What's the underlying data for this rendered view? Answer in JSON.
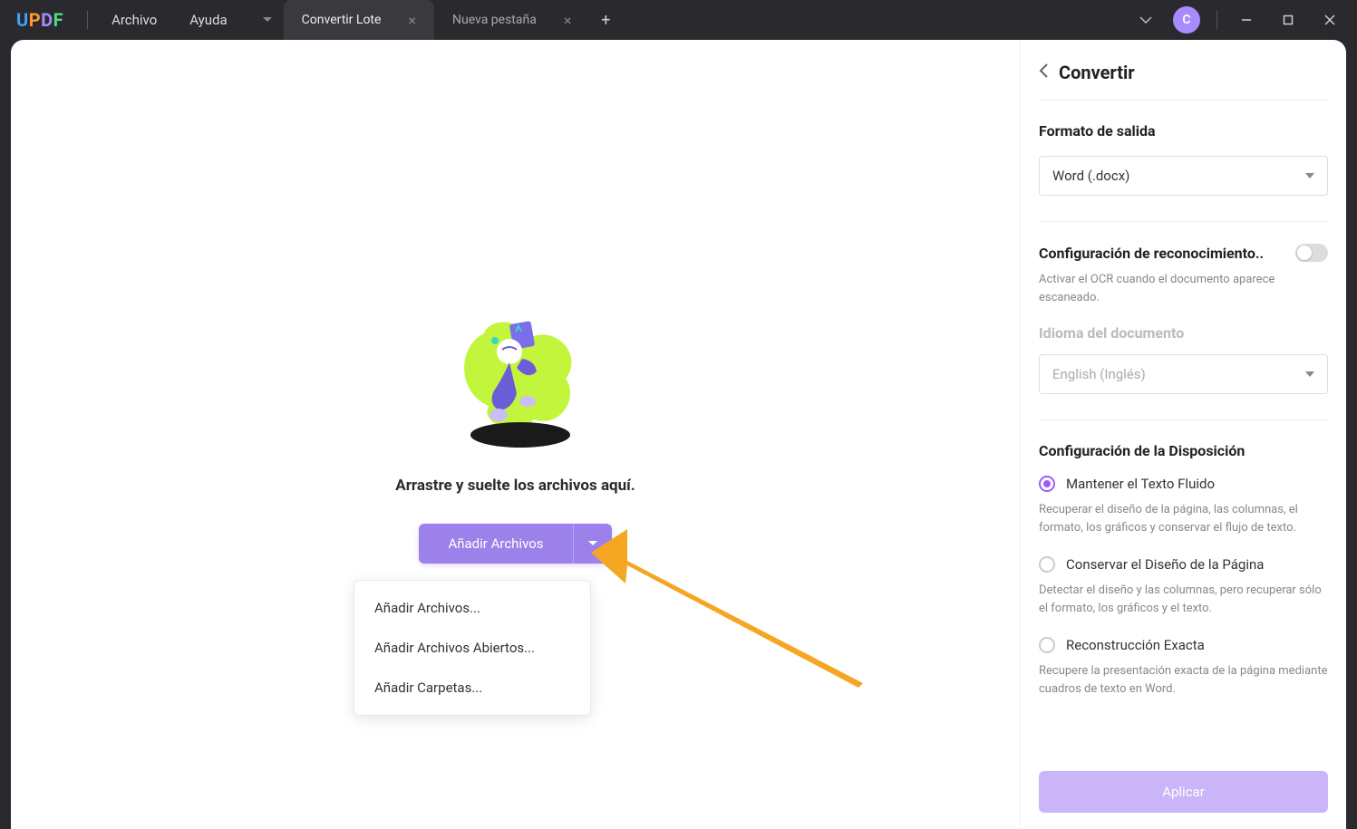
{
  "app": {
    "logo": "UPDF"
  },
  "menu": {
    "file": "Archivo",
    "help": "Ayuda"
  },
  "tabs": {
    "items": [
      {
        "label": "Convertir Lote",
        "active": true
      },
      {
        "label": "Nueva pestaña",
        "active": false
      }
    ]
  },
  "avatar": {
    "initial": "C"
  },
  "main": {
    "drop_text": "Arrastre y suelte los archivos aquí.",
    "add_button": "Añadir Archivos",
    "dropdown": {
      "add_files": "Añadir Archivos...",
      "add_open": "Añadir Archivos Abiertos...",
      "add_folders": "Añadir Carpetas..."
    }
  },
  "sidebar": {
    "title": "Convertir",
    "output_format_label": "Formato de salida",
    "output_format_value": "Word (.docx)",
    "ocr_label": "Configuración de reconocimiento..",
    "ocr_desc": "Activar el OCR cuando el documento aparece escaneado.",
    "ocr_enabled": false,
    "lang_label": "Idioma del documento",
    "lang_value": "English (Inglés)",
    "layout_label": "Configuración de la Disposición",
    "layout_options": {
      "flowing": {
        "label": "Mantener el Texto Fluido",
        "desc": "Recuperar el diseño de la página, las columnas, el formato, los gráficos y conservar el flujo de texto."
      },
      "preserve": {
        "label": "Conservar el Diseño de la Página",
        "desc": "Detectar el diseño y las columnas, pero recuperar sólo el formato, los gráficos y el texto."
      },
      "exact": {
        "label": "Reconstrucción Exacta",
        "desc": "Recupere la presentación exacta de la página mediante cuadros de texto en Word."
      }
    },
    "layout_selected": "flowing",
    "apply": "Aplicar"
  },
  "colors": {
    "accent": "#9b81e9",
    "accent_radio": "#9b5cff"
  }
}
